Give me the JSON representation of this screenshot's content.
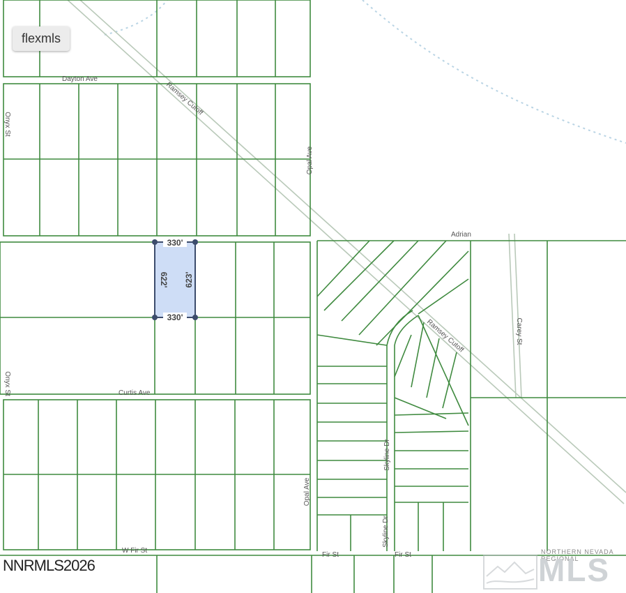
{
  "brand": {
    "badge_label": "flexmls"
  },
  "copyright": "NNRMLS2026",
  "mls_logo": {
    "small_text": "NORTHERN NEVADA REGIONAL",
    "big_text": "MLS"
  },
  "streets": {
    "dayton": "Dayton Ave",
    "ramsey_upper": "Ramsey Cutoff",
    "ramsey_lower": "Ramsey Cutoff",
    "onyx_upper": "Onyx St",
    "onyx_lower": "Onyx St",
    "opal_upper": "Opal Ave",
    "opal_lower": "Opal Ave",
    "adrian": "Adrian",
    "carey": "Carey St",
    "curtis": "Curtis Ave",
    "skyline_upper": "Skyline Dr",
    "skyline_lower": "Skyline Dr",
    "w_fir": "W Fir St",
    "fir_1": "Fir St",
    "fir_2": "Fir St"
  },
  "parcel": {
    "top_dim": "330'",
    "bottom_dim": "330'",
    "left_dim": "622'",
    "right_dim": "623'",
    "fill_color": "#c9d9f5",
    "edge_color": "#3c4c6c"
  },
  "colors": {
    "lot_line": "#3f8a3f",
    "road": "#b9c9b9",
    "trail": "#b9d4e4"
  }
}
